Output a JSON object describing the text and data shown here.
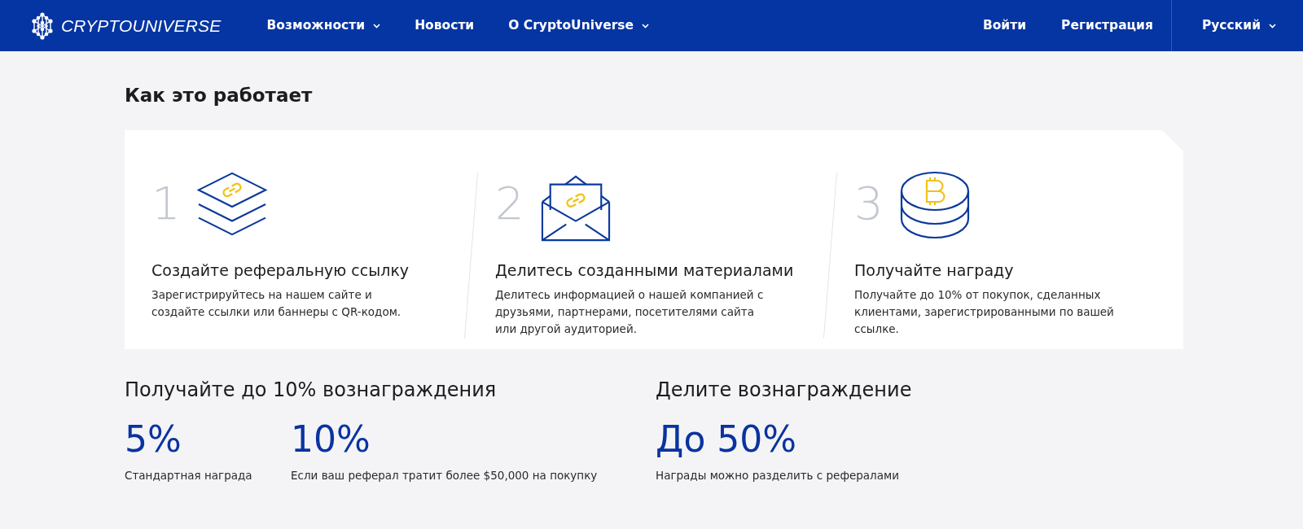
{
  "header": {
    "logo": "CRYPTOUNIVERSE",
    "nav": [
      {
        "label": "Возможности",
        "dropdown": true
      },
      {
        "label": "Новости",
        "dropdown": false
      },
      {
        "label": "О CryptoUniverse",
        "dropdown": true
      }
    ],
    "account_links": [
      "Войти",
      "Регистрация"
    ],
    "language": {
      "label": "Русский",
      "dropdown": true
    }
  },
  "how_it_works": {
    "title": "Как это работает",
    "steps": [
      {
        "number": "1",
        "kind": "layers",
        "title": "Создайте реферальную ссылку",
        "description": "Зарегистрируйтесь на нашем сайте и создайте ссылки или баннеры с QR-кодом."
      },
      {
        "number": "2",
        "kind": "envelope",
        "title": "Делитесь созданными материалами",
        "description": "Делитесь информацией о нашей компанией с друзьями, партнерами, посетителями сайта или другой аудиторией."
      },
      {
        "number": "3",
        "kind": "coins",
        "title": "Получайте награду",
        "description": "Получайте до 10% от покупок, сделанных клиентами, зарегистрированными по вашей ссылке."
      }
    ]
  },
  "rewards": [
    {
      "heading": "Получайте до 10% вознаграждения",
      "stats": [
        {
          "value": "5%",
          "caption": "Стандартная награда"
        },
        {
          "value": "10%",
          "caption": "Если ваш реферал тратит более $50,000 на покупку"
        }
      ]
    },
    {
      "heading": "Делите вознаграждение",
      "stats": [
        {
          "value": "До 50%",
          "caption": "Награды можно разделить с рефералами"
        }
      ]
    }
  ]
}
